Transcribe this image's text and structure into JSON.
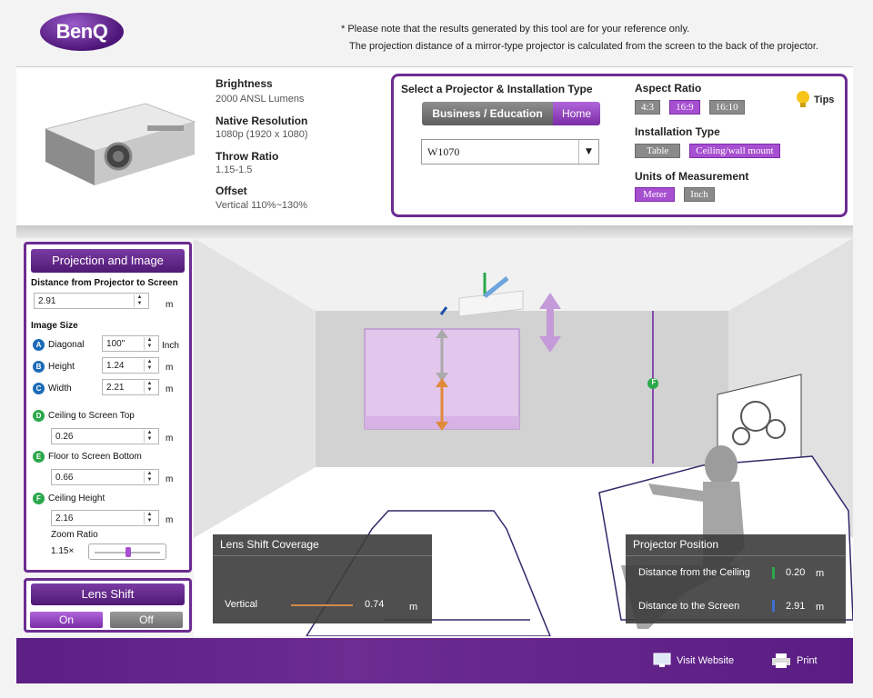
{
  "brand": {
    "logo_text": "BenQ"
  },
  "notes": {
    "line1": "* Please note that the results generated by this tool are for your reference only.",
    "line2": "The projection distance of a mirror-type projector is calculated from the screen to the back of the projector."
  },
  "specs": [
    {
      "title": "Brightness",
      "value": "2000 ANSL Lumens"
    },
    {
      "title": "Native Resolution",
      "value": "1080p (1920 x 1080)"
    },
    {
      "title": "Throw Ratio",
      "value": "1.15-1.5"
    },
    {
      "title": "Offset",
      "value": "Vertical 110%~130%"
    }
  ],
  "selector": {
    "title": "Select a Projector & Installation Type",
    "segments": [
      "Business / Education",
      "Home"
    ],
    "selected_segment": "Home",
    "model_value": "W1070"
  },
  "aspect_ratio": {
    "label": "Aspect Ratio",
    "options": [
      "4:3",
      "16:9",
      "16:10"
    ],
    "selected": "16:9"
  },
  "tips_label": "Tips",
  "installation": {
    "label": "Installation Type",
    "options": [
      "Table",
      "Ceiling/wall mount"
    ],
    "selected": "Ceiling/wall mount"
  },
  "units": {
    "label": "Units of Measurement",
    "options": [
      "Meter",
      "Inch"
    ],
    "selected": "Meter"
  },
  "projection": {
    "title": "Projection and Image",
    "distance_label": "Distance from Projector to Screen",
    "distance_value": "2.91",
    "distance_unit": "m",
    "image_size_label": "Image Size",
    "diagonal": {
      "badge": "A",
      "label": "Diagonal",
      "value": "100\"",
      "unit": "Inch"
    },
    "height": {
      "badge": "B",
      "label": "Height",
      "value": "1.24",
      "unit": "m"
    },
    "width": {
      "badge": "C",
      "label": "Width",
      "value": "2.21",
      "unit": "m"
    },
    "ceiling_top": {
      "badge": "D",
      "label": "Ceiling to Screen Top",
      "value": "0.26",
      "unit": "m"
    },
    "floor_bottom": {
      "badge": "E",
      "label": "Floor to Screen Bottom",
      "value": "0.66",
      "unit": "m"
    },
    "ceiling_height": {
      "badge": "F",
      "label": "Ceiling Height",
      "value": "2.16",
      "unit": "m"
    },
    "zoom_label": "Zoom Ratio",
    "zoom_value": "1.15×"
  },
  "lens_shift": {
    "title": "Lens Shift",
    "on": "On",
    "off": "Off",
    "selected": "On"
  },
  "lens_coverage": {
    "title": "Lens Shift Coverage",
    "vertical_label": "Vertical",
    "vertical_value": "0.74",
    "unit": "m"
  },
  "projector_position": {
    "title": "Projector Position",
    "ceiling_label": "Distance from the Ceiling",
    "ceiling_value": "0.20",
    "screen_label": "Distance to the Screen",
    "screen_value": "2.91",
    "unit": "m"
  },
  "footer": {
    "visit": "Visit Website",
    "print": "Print"
  },
  "room_marker": "F"
}
